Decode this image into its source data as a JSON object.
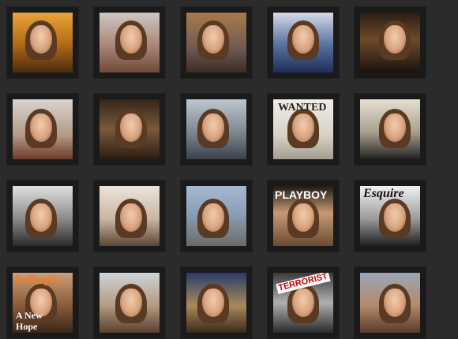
{
  "gallery": {
    "background": "#2b2b2b",
    "tile_background": "#1a1a1a",
    "thumbnails": [
      {
        "caption": "",
        "bg": "linear-gradient(180deg,#e9a43a 0%,#b86d18 50%,#4a2c10 100%)"
      },
      {
        "caption": "",
        "bg": "linear-gradient(180deg,#cfc7c1 0%,#a9867a 55%,#6d4a3a 100%)"
      },
      {
        "caption": "",
        "bg": "linear-gradient(180deg,#a87a4c 0%,#6e5a52 60%,#3a2c24 100%)"
      },
      {
        "caption": "",
        "bg": "linear-gradient(180deg,#d7dbe4 0%,#5d78a8 50%,#1d2d55 100%)"
      },
      {
        "caption": "",
        "bg": "linear-gradient(180deg,#2a1d14 0%,#6e4a2a 45%,#1a120d 100%)"
      },
      {
        "caption": "",
        "bg": "linear-gradient(180deg,#d8d4cf 0%,#b39a87 60%,#6e3a2a 100%)"
      },
      {
        "caption": "",
        "bg": "linear-gradient(180deg,#35251a 0%,#7a5a3a 50%,#2a1c12 100%)"
      },
      {
        "caption": "",
        "bg": "linear-gradient(180deg,#bfc6cf 0%,#7d8792 55%,#3b414a 100%)"
      },
      {
        "caption": "WANTED",
        "bg": "linear-gradient(180deg,#f1ede5 0%,#d8d2c6 60%,#a49c92 100%)"
      },
      {
        "caption": "",
        "bg": "linear-gradient(180deg,#e6e0d2 0%,#a89f8c 55%,#222 100%)"
      },
      {
        "caption": "",
        "bg": "linear-gradient(180deg,#e0e0e0 0%,#8a8a8a 55%,#2a2a2a 100%)"
      },
      {
        "caption": "",
        "bg": "linear-gradient(180deg,#ece4da 0%,#c9b6a2 55%,#5a4636 100%)"
      },
      {
        "caption": "",
        "bg": "linear-gradient(180deg,#a6b9cf 0%,#8aa0b8 45%,#6a6a6a 100%)"
      },
      {
        "caption": "PLAYBOY",
        "bg": "linear-gradient(180deg,#201a16 0%,#c59a74 45%,#6a4a34 100%)"
      },
      {
        "caption": "Esquire",
        "bg": "linear-gradient(180deg,#f2f2f2 0%,#9a9a9a 55%,#1e1e1e 100%)"
      },
      {
        "caption": "RollingSt",
        "bg": "linear-gradient(180deg,#c9a17a 0%,#8a5a3a 55%,#3a2618 100%)"
      },
      {
        "caption": "",
        "bg": "linear-gradient(180deg,#cfd4da 0%,#b39a80 55%,#5a4030 100%)"
      },
      {
        "caption": "",
        "bg": "linear-gradient(180deg,#2a3a6a 0%,#a88a5a 55%,#3a2a1a 100%)"
      },
      {
        "caption": "TERRORIST",
        "bg": "linear-gradient(180deg,#3a3a3a 0%,#b0b0b0 50%,#2a2a2a 100%)"
      },
      {
        "caption": "",
        "bg": "linear-gradient(180deg,#9aa6b8 0%,#b38a6a 55%,#5a3a2a 100%)"
      }
    ],
    "extra_texts": {
      "rolling_sub": "A New",
      "rolling_sub2": "Hope"
    }
  }
}
